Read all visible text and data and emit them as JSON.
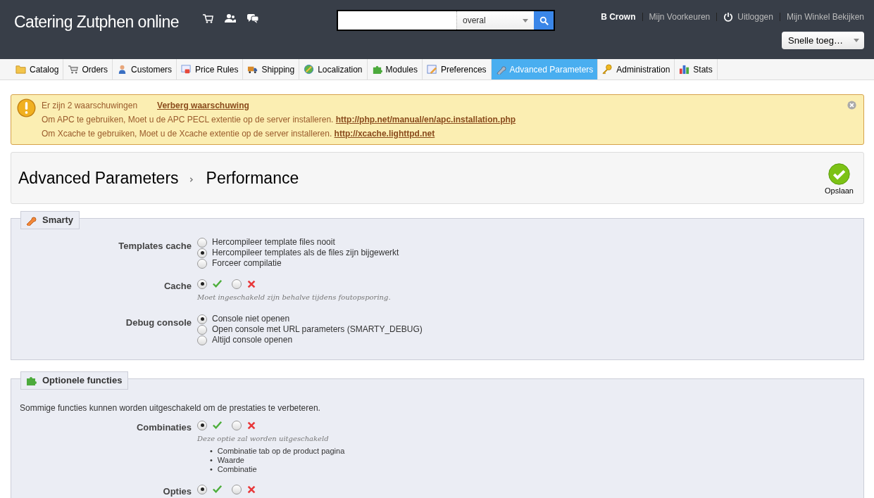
{
  "header": {
    "title": "Catering Zutphen online",
    "search": {
      "scope": "overal"
    },
    "user_links": [
      {
        "text": "B Crown",
        "kind": "user"
      },
      {
        "text": "Mijn Voorkeuren",
        "kind": "link"
      },
      {
        "text": "Uitloggen",
        "kind": "logout"
      },
      {
        "text": "Mijn Winkel Bekijken",
        "kind": "link"
      }
    ],
    "quick_access": "Snelle toeg…"
  },
  "tabs": [
    {
      "label": "Catalog",
      "selected": false
    },
    {
      "label": "Orders",
      "selected": false
    },
    {
      "label": "Customers",
      "selected": false
    },
    {
      "label": "Price Rules",
      "selected": false
    },
    {
      "label": "Shipping",
      "selected": false
    },
    {
      "label": "Localization",
      "selected": false
    },
    {
      "label": "Modules",
      "selected": false
    },
    {
      "label": "Preferences",
      "selected": false
    },
    {
      "label": "Advanced Parameters",
      "selected": true
    },
    {
      "label": "Administration",
      "selected": false
    },
    {
      "label": "Stats",
      "selected": false
    }
  ],
  "warning": {
    "summary": "Er zijn 2 waarschuwingen",
    "hide_link": "Verberg waarschuwing",
    "messages": [
      {
        "text": "Om APC te gebruiken, Moet u de APC PECL extentie op de server installeren.",
        "link": "http://php.net/manual/en/apc.installation.php"
      },
      {
        "text": "Om Xcache te gebruiken, Moet u de Xcache extentie op de server installeren.",
        "link": "http://xcache.lighttpd.net"
      }
    ]
  },
  "page_title": {
    "breadcrumb": [
      "Advanced Parameters",
      "Performance"
    ],
    "save": "Opslaan"
  },
  "sections": [
    {
      "title": "Smarty",
      "fields": [
        {
          "label": "Templates cache",
          "kind": "radio-list",
          "options": [
            {
              "label": "Hercompileer template files nooit",
              "selected": false
            },
            {
              "label": "Hercompileer templates als de files zijn bijgewerkt",
              "selected": true
            },
            {
              "label": "Forceer compilatie",
              "selected": false
            }
          ]
        },
        {
          "label": "Cache",
          "kind": "yesno",
          "options": [
            {
              "selected": true
            },
            {
              "selected": false
            }
          ],
          "hint": "Moet ingeschakeld zijn behalve tijdens foutopsporing."
        },
        {
          "label": "Debug console",
          "kind": "radio-list",
          "options": [
            {
              "label": "Console niet openen",
              "selected": true
            },
            {
              "label": "Open console met URL parameters (SMARTY_DEBUG)",
              "selected": false
            },
            {
              "label": "Altijd console openen",
              "selected": false
            }
          ]
        }
      ]
    },
    {
      "title": "Optionele functies",
      "intro": "Sommige functies kunnen worden uitgeschakeld om de prestaties te verbeteren.",
      "fields": [
        {
          "label": "Combinaties",
          "kind": "yesno",
          "options": [
            {
              "selected": true
            },
            {
              "selected": false
            }
          ],
          "hint": "Deze optie zal worden uitgeschakeld",
          "bullets": [
            {
              "marker": "•",
              "text": "Combinatie tab op de product pagina"
            },
            {
              "marker": "•",
              "text": "Waarde"
            },
            {
              "marker": "•",
              "text": "Combinatie"
            }
          ]
        },
        {
          "label": "Opties",
          "kind": "yesno",
          "options": [
            {
              "selected": true
            },
            {
              "selected": false
            }
          ]
        }
      ]
    }
  ]
}
